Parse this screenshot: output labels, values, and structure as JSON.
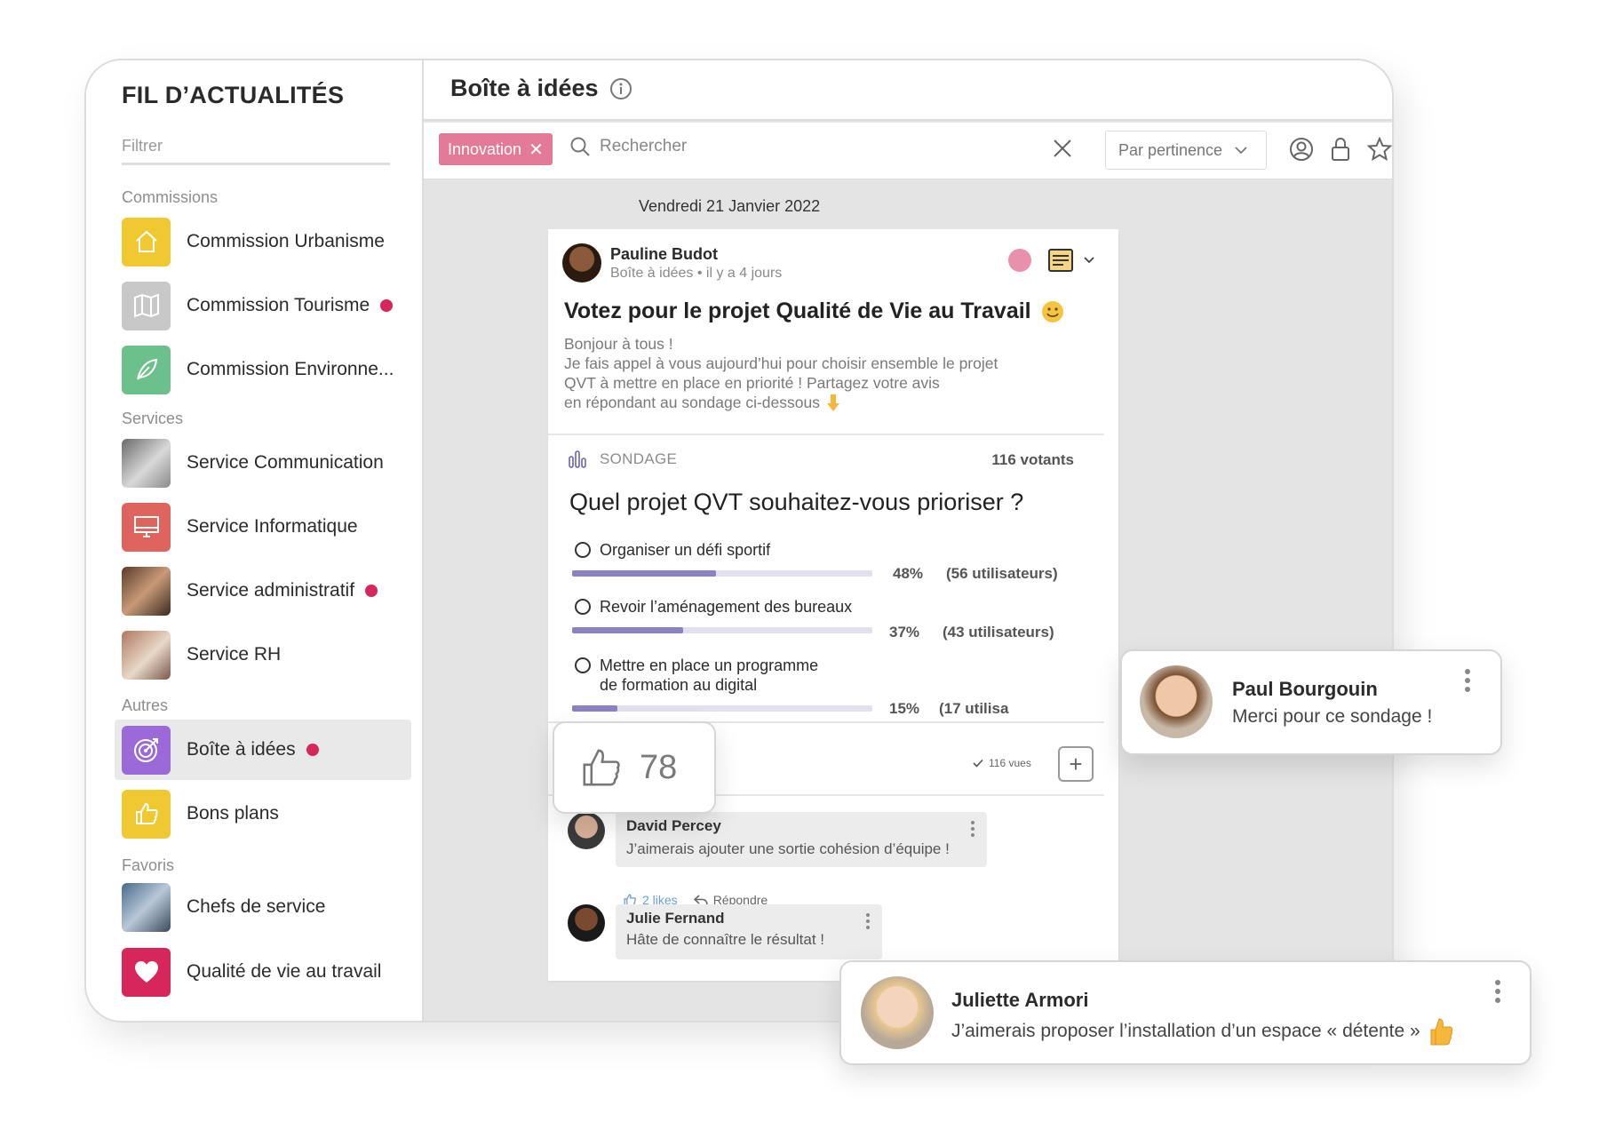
{
  "sidebar": {
    "title": "FIL D’ACTUALITÉS",
    "filter_label": "Filtrer",
    "sections": {
      "commissions": "Commissions",
      "services": "Services",
      "autres": "Autres",
      "favoris": "Favoris"
    },
    "items": [
      {
        "label": "Commission Urbanisme",
        "icon": "house-icon",
        "color": "#f0c832"
      },
      {
        "label": "Commission Tourisme",
        "icon": "map-icon",
        "color": "#c8c8c8",
        "dot": true
      },
      {
        "label": "Commission Environne...",
        "icon": "leaf-icon",
        "color": "#6cc08c"
      },
      {
        "label": "Service Communication",
        "icon": "photo-communication"
      },
      {
        "label": "Service Informatique",
        "icon": "monitor-icon",
        "color": "#e0645e"
      },
      {
        "label": "Service administratif",
        "icon": "photo-administratif",
        "dot": true
      },
      {
        "label": "Service RH",
        "icon": "photo-rh"
      },
      {
        "label": "Boîte à idées",
        "icon": "target-icon",
        "color": "#9b6ad8",
        "dot": true,
        "active": true
      },
      {
        "label": "Bons plans",
        "icon": "thumbs-up-icon",
        "color": "#f0c832"
      },
      {
        "label": "Chefs de service",
        "icon": "photo-chefs"
      },
      {
        "label": "Qualité de vie au travail",
        "icon": "heart-icon",
        "color": "#d6265c"
      }
    ]
  },
  "header": {
    "title": "Boîte à idées",
    "info_icon": "info-icon"
  },
  "toolbar": {
    "chip_label": "Innovation",
    "search_placeholder": "Rechercher",
    "sort_label": "Par pertinence",
    "icons": [
      "user-circle-icon",
      "lock-icon",
      "star-icon"
    ]
  },
  "feed": {
    "date": "Vendredi 21 Janvier 2022"
  },
  "post": {
    "author": "Pauline Budot",
    "meta_group": "Boîte à idées",
    "meta_time": "il y a 4 jours",
    "title": "Votez pour le projet Qualité de Vie au Travail",
    "body": [
      "Bonjour à tous !",
      "Je fais appel à vous aujourd’hui pour choisir ensemble le projet",
      "QVT à mettre en place en priorité ! Partagez votre avis",
      "en répondant au sondage ci-dessous"
    ],
    "pink_color": "#e890ac"
  },
  "poll": {
    "label": "SONDAGE",
    "votes": "116 votants",
    "question": "Quel projet QVT souhaitez-vous prioriser ?",
    "options": [
      {
        "label_lines": [
          "Organiser un défi sportif"
        ],
        "percent_text": "48%",
        "users": "(56 utilisateurs)",
        "percent": 0.48
      },
      {
        "label_lines": [
          "Revoir l’aménagement des bureaux"
        ],
        "percent_text": "37%",
        "users": "(43 utilisateurs)",
        "percent": 0.37
      },
      {
        "label_lines": [
          "Mettre en place un programme",
          "de formation au digital"
        ],
        "percent_text": "15%",
        "users": "(17 utilisa",
        "percent": 0.15
      }
    ],
    "views": "116 vues"
  },
  "likes": {
    "count": "78"
  },
  "comments": [
    {
      "author": "David Percey",
      "text": "J’aimerais ajouter une sortie cohésion d’équipe !",
      "likes": "2 likes",
      "reply": "Répondre"
    },
    {
      "author": "Julie Fernand",
      "text": "Hâte de connaître le résultat !"
    }
  ],
  "floating": {
    "paul": {
      "author": "Paul Bourgouin",
      "text": "Merci pour ce sondage !"
    },
    "juliette": {
      "author": "Juliette Armori",
      "text": "J’aimerais proposer l’installation d’un espace « détente »"
    }
  }
}
